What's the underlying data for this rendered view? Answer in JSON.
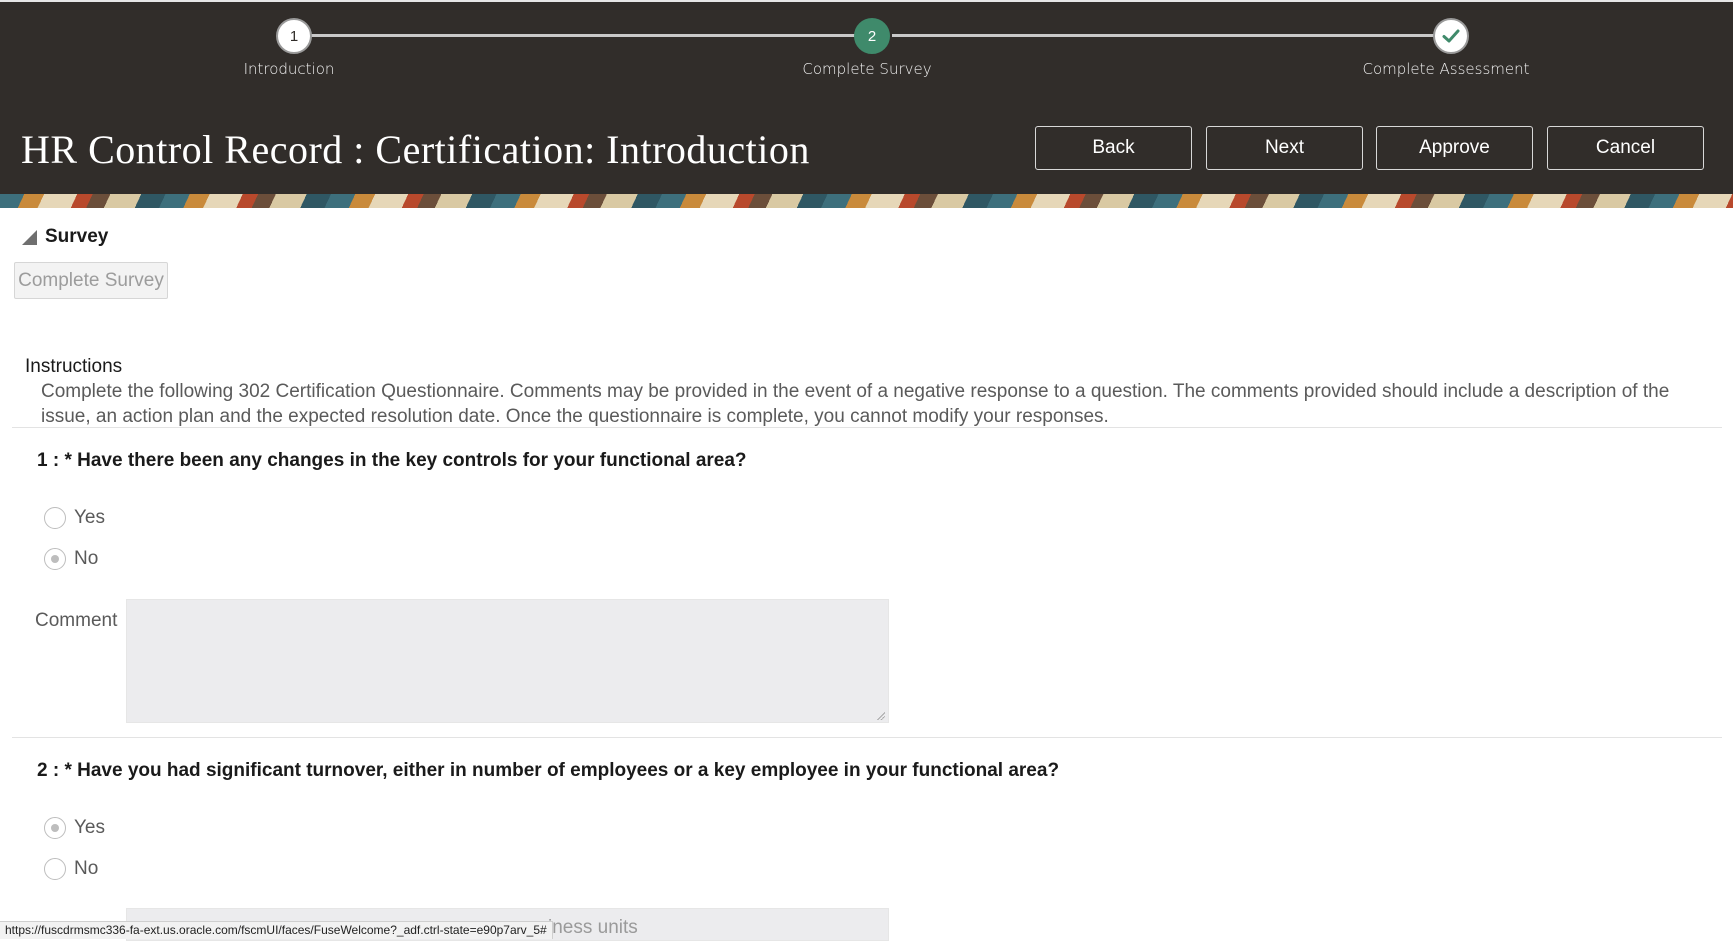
{
  "train": {
    "stops": [
      {
        "number": "1",
        "label": "Introduction"
      },
      {
        "number": "2",
        "label": "Complete Survey"
      },
      {
        "number": "",
        "label": "Complete Assessment",
        "icon": "checkmark-icon"
      }
    ],
    "current_index": 1
  },
  "header": {
    "title": "HR Control Record : Certification: Introduction",
    "buttons": {
      "back": "Back",
      "next": "Next",
      "approve": "Approve",
      "cancel": "Cancel"
    }
  },
  "survey": {
    "section_title": "Survey",
    "complete_survey_button": "Complete Survey",
    "instructions_label": "Instructions",
    "instructions_text": "Complete the following 302 Certification Questionnaire. Comments may be provided in the event of a negative response to a question. The comments provided should include a description of the issue, an action plan and the expected resolution date. Once the questionnaire is complete, you cannot modify your responses.",
    "questions": [
      {
        "text": "1 : * Have there been any changes in the key controls for your functional area?",
        "options": [
          "Yes",
          "No"
        ],
        "selected": "No",
        "comment_label": "Comment",
        "comment_value": ""
      },
      {
        "text": "2 : * Have you had significant turnover, either in number of employees or a key employee in your functional area?",
        "options": [
          "Yes",
          "No"
        ],
        "selected": "Yes"
      }
    ],
    "partial_text": "iness units"
  },
  "status_bar": {
    "url": "https://fuscdrmsmc336-fa-ext.us.oracle.com/fscmUI/faces/FuseWelcome?_adf.ctrl-state=e90p7arv_5#"
  },
  "colors": {
    "header_bg": "#312d2a",
    "current_step": "#3f8a6b"
  }
}
